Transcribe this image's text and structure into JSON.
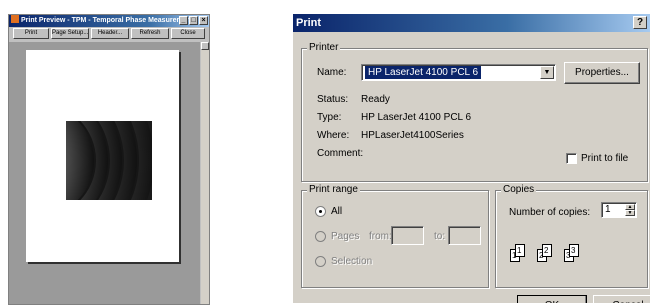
{
  "preview_window": {
    "title": "Print Preview - TPM - Temporal Phase Measurements",
    "controls": {
      "minimize": "_",
      "maximize": "□",
      "close": "×"
    },
    "toolbar": {
      "print": "Print",
      "page_setup": "Page Setup...",
      "header": "Header...",
      "refresh": "Refresh",
      "close": "Close"
    }
  },
  "print_dialog": {
    "title": "Print",
    "help": "?",
    "printer_group": {
      "legend": "Printer",
      "name_label": "Name:",
      "name_value": "HP LaserJet 4100 PCL 6",
      "properties_button": "Properties...",
      "status_label": "Status:",
      "status_value": "Ready",
      "type_label": "Type:",
      "type_value": "HP LaserJet 4100 PCL 6",
      "where_label": "Where:",
      "where_value": "HPLaserJet4100Series",
      "comment_label": "Comment:",
      "print_to_file": "Print to file",
      "print_to_file_checked": false
    },
    "print_range": {
      "legend": "Print range",
      "all": "All",
      "pages": "Pages",
      "from": "from:",
      "to": "to:",
      "selection": "Selection",
      "selected": "All"
    },
    "copies": {
      "legend": "Copies",
      "number_label": "Number of copies:",
      "number_value": "1",
      "collate_pages": [
        "1",
        "1",
        "2",
        "2",
        "3",
        "3"
      ]
    },
    "buttons": {
      "ok": "OK",
      "cancel": "Cancel"
    }
  },
  "colors": {
    "titlebar": "#0a246a",
    "dialog_face": "#d4d0c8",
    "selection": "#0a246a"
  }
}
